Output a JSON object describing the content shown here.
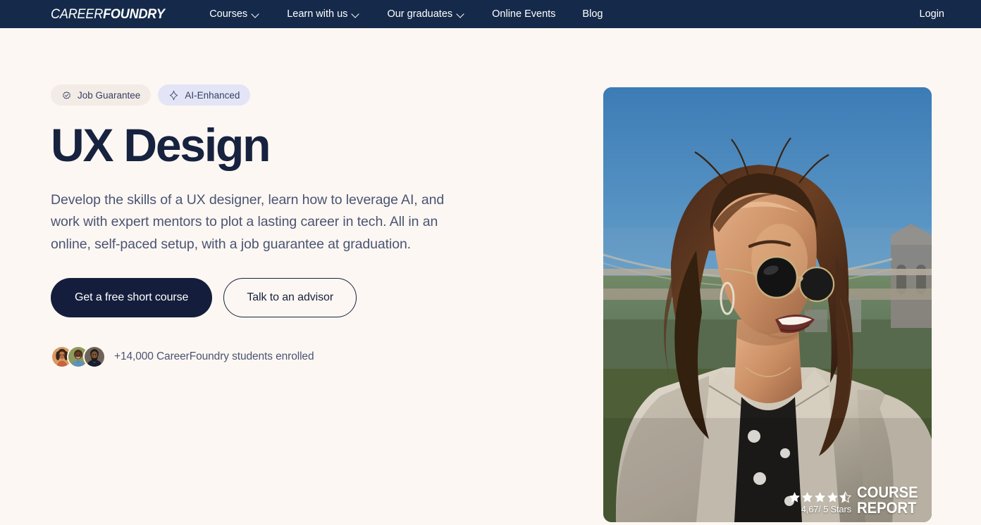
{
  "brand": {
    "logo_thin": "CAREER",
    "logo_bold": "FOUNDRY",
    "navy": "#152A4A",
    "cream": "#FDF7F3",
    "ink": "#17223F",
    "body_text": "#4A5472",
    "badge_job_bg": "#F3ECE6",
    "badge_ai_bg": "#E3E5F6"
  },
  "nav": {
    "items": [
      {
        "label": "Courses",
        "has_dropdown": true,
        "icon": "chevron-down-icon"
      },
      {
        "label": "Learn with us",
        "has_dropdown": true,
        "icon": "chevron-down-icon"
      },
      {
        "label": "Our graduates",
        "has_dropdown": true,
        "icon": "chevron-down-icon"
      },
      {
        "label": "Online Events",
        "has_dropdown": false
      },
      {
        "label": "Blog",
        "has_dropdown": false
      }
    ],
    "login_label": "Login"
  },
  "hero": {
    "badges": [
      {
        "label": "Job Guarantee",
        "icon": "verified-check-icon",
        "bg": "#F3ECE6"
      },
      {
        "label": "AI-Enhanced",
        "icon": "sparkle-icon",
        "bg": "#E3E5F6"
      }
    ],
    "title": "UX Design",
    "description": "Develop the skills of a UX designer, learn how to leverage AI, and work with expert mentors to plot a lasting career in tech. All in an online, self-paced setup, with a job guarantee at graduation.",
    "primary_cta": "Get a free short course",
    "secondary_cta": "Talk to an advisor",
    "social_proof_text": "+14,000 CareerFoundry students enrolled",
    "avatars": [
      {
        "name": "student-avatar-1"
      },
      {
        "name": "student-avatar-2"
      },
      {
        "name": "student-avatar-3"
      }
    ],
    "image_alt": "Smiling woman wearing sunglasses and a beige blazer outdoors with the Brooklyn Bridge behind her"
  },
  "course_report": {
    "rating_text": "4,67/ 5 Stars",
    "stars_full": 4,
    "stars_half": 1,
    "brand_line_1": "COURSE",
    "brand_line_2": "REPORT"
  }
}
